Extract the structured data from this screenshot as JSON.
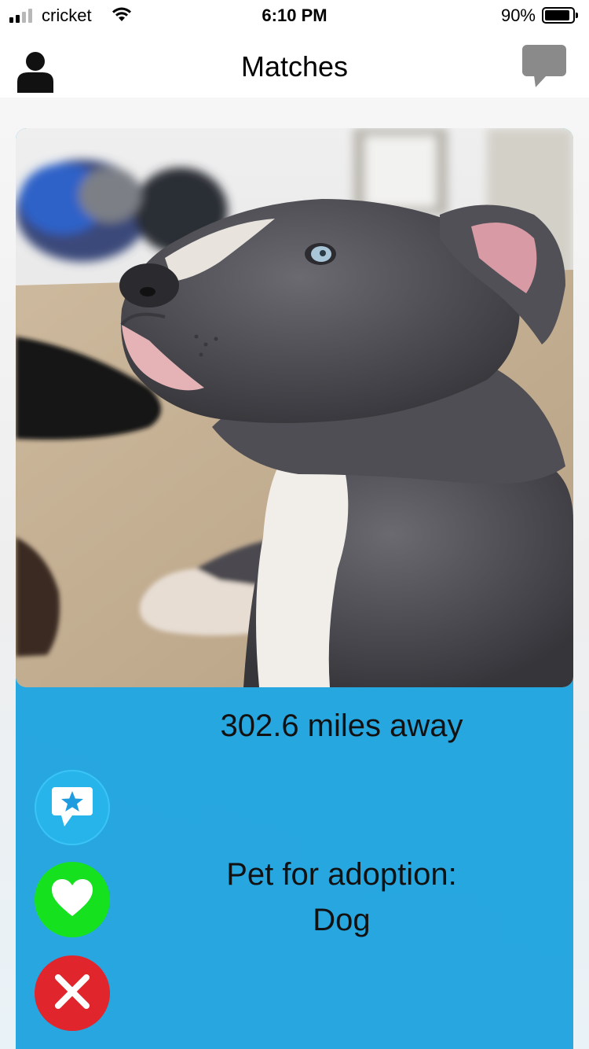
{
  "status_bar": {
    "carrier": "cricket",
    "time": "6:10 PM",
    "battery_percent": "90%",
    "battery_level": 0.9,
    "signal_bars_filled": 2,
    "signal_bars_total": 4
  },
  "nav": {
    "title": "Matches",
    "left_icon": "profile-person-icon",
    "right_icon": "chat-bubble-icon"
  },
  "card": {
    "photo_subject": "gray-and-white-dog-photo",
    "distance_text": "302.6 miles away",
    "pet_label_line1": "Pet for adoption:",
    "pet_label_line2": "Dog"
  },
  "actions": [
    {
      "name": "super-like",
      "icon": "star-chat-icon",
      "color": "#27b4ea"
    },
    {
      "name": "like",
      "icon": "heart-icon",
      "color": "#16e11f"
    },
    {
      "name": "pass",
      "icon": "close-x-icon",
      "color": "#e0262c"
    }
  ],
  "colors": {
    "card_background": "#27a6e0",
    "card_gradient_accent": "#22b8c8"
  }
}
